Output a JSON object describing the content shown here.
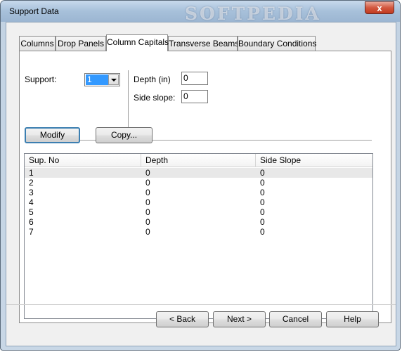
{
  "window": {
    "title": "Support Data",
    "watermark": "SOFTPEDIA",
    "close_glyph": "x"
  },
  "tabs": [
    {
      "label": "Columns",
      "active": false
    },
    {
      "label": "Drop Panels",
      "active": false
    },
    {
      "label": "Column Capitals",
      "active": true
    },
    {
      "label": "Transverse Beams",
      "active": false
    },
    {
      "label": "Boundary Conditions",
      "active": false
    }
  ],
  "form": {
    "support_label": "Support:",
    "support_value": "1",
    "depth_label": "Depth (in)",
    "depth_value": "0",
    "side_slope_label": "Side slope:",
    "side_slope_value": "0"
  },
  "actions": {
    "modify_label": "Modify",
    "copy_label": "Copy..."
  },
  "table": {
    "columns": [
      "Sup. No",
      "Depth",
      "Side Slope"
    ],
    "rows": [
      [
        "1",
        "0",
        "0"
      ],
      [
        "2",
        "0",
        "0"
      ],
      [
        "3",
        "0",
        "0"
      ],
      [
        "4",
        "0",
        "0"
      ],
      [
        "5",
        "0",
        "0"
      ],
      [
        "6",
        "0",
        "0"
      ],
      [
        "7",
        "0",
        "0"
      ]
    ],
    "selected_row": 0
  },
  "footer": {
    "back_label": "< Back",
    "next_label": "Next >",
    "cancel_label": "Cancel",
    "help_label": "Help"
  }
}
